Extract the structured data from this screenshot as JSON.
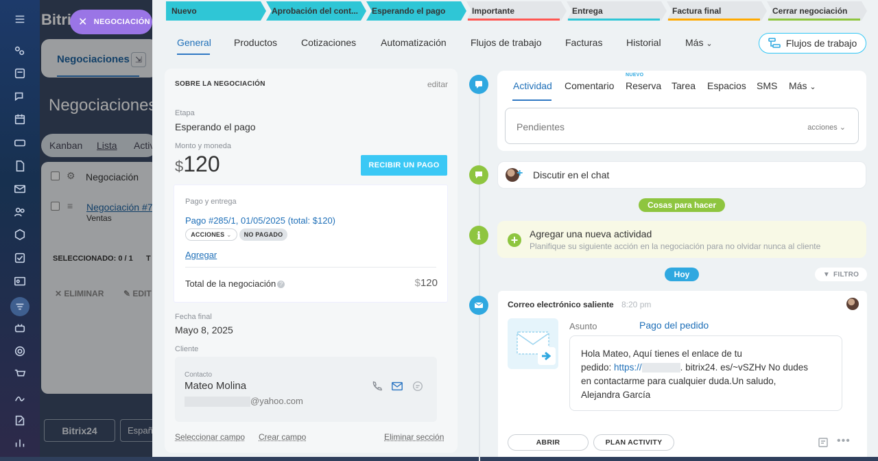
{
  "background": {
    "logo": "Bitri",
    "tab": "Negociaciones",
    "title": "Negociaciones",
    "view_modes": [
      "Kanban",
      "Lista",
      "Activ"
    ],
    "grid_header": "Negociación",
    "row_title": "Negociación #7!",
    "row_sub": "Ventas",
    "selected": "SELECCIONADO: 0 / 1",
    "selected_extra": "T",
    "delete": "ELIMINAR",
    "edit": "EDIT",
    "footer_logo": "Bitrix24",
    "footer_lang": "Españ"
  },
  "chip": {
    "label": "NEGOCIACIÓN"
  },
  "stages": [
    {
      "label": "Nuevo",
      "color": "#2fc6d6"
    },
    {
      "label": "Aprobación del cont...",
      "color": "#2fc6d6"
    },
    {
      "label": "Esperando el pago",
      "color": "#2fc6d6"
    },
    {
      "label": "Importante",
      "color": "#e3e6e9",
      "accent": "#ff5752"
    },
    {
      "label": "Entrega",
      "color": "#e3e6e9",
      "accent": "#2fc6d6"
    },
    {
      "label": "Factura final",
      "color": "#e3e6e9",
      "accent": "#ffa900"
    },
    {
      "label": "Cerrar negociación",
      "color": "#e3e6e9",
      "accent": "#8ec53f"
    }
  ],
  "tabs": [
    "General",
    "Productos",
    "Cotizaciones",
    "Automatización",
    "Flujos de trabajo",
    "Facturas",
    "Historial",
    "Más"
  ],
  "flujos_button": "Flujos de trabajo",
  "about": {
    "header": "SOBRE LA NEGOCIACIÓN",
    "edit": "editar",
    "stage_label": "Etapa",
    "stage_value": "Esperando el pago",
    "amount_label": "Monto y moneda",
    "currency": "$",
    "amount": "120",
    "receive_button": "RECIBIR UN PAGO",
    "payment": {
      "title": "Pago y entrega",
      "link": "Pago #285/1, 01/05/2025 (total: $120)",
      "actions": "ACCIONES",
      "status": "NO PAGADO",
      "add": "Agregar",
      "total_label": "Total de la negociación",
      "total_currency": "$",
      "total_value": "120"
    },
    "end_label": "Fecha final",
    "end_value": "Mayo 8, 2025",
    "client_label": "Cliente",
    "contact_label": "Contacto",
    "contact_name": "Mateo Molina",
    "contact_email_domain": "@yahoo.com",
    "links": [
      "Seleccionar campo",
      "Crear campo",
      "Eliminar sección"
    ]
  },
  "activity": {
    "tabs": [
      "Actividad",
      "Comentario",
      "Reserva",
      "Tarea",
      "Espacios",
      "SMS",
      "Más"
    ],
    "new_badge": "NUEVO",
    "pending": "Pendientes",
    "actions": "acciones",
    "chat": "Discutir en el chat",
    "todo_badge": "Cosas para hacer",
    "new_activity_title": "Agregar una nueva actividad",
    "new_activity_sub": "Planifique su siguiente acción en la negociación para no olvidar nunca al cliente",
    "today_badge": "Hoy",
    "filter": "FILTRO"
  },
  "email": {
    "title": "Correo electrónico saliente",
    "time": "8:20 pm",
    "subject_label": "Asunto",
    "subject": "Pago del pedido",
    "line1": "Hola Mateo, Aquí tienes el enlace de tu",
    "line2a": "pedido: ",
    "line2_link": "https://",
    "line2b": ". bitrix24. es/~vSZHv No dudes",
    "line3": "en contactarme para cualquier duda.Un saludo,",
    "line4": "Alejandra García",
    "open_button": "ABRIR",
    "plan_button": "PLAN ACTIVITY"
  },
  "colors": {
    "accent": "#2fc6f6",
    "link": "#1e6fb8",
    "green": "#8ec53f",
    "blue_dot": "#2fa8e0"
  }
}
